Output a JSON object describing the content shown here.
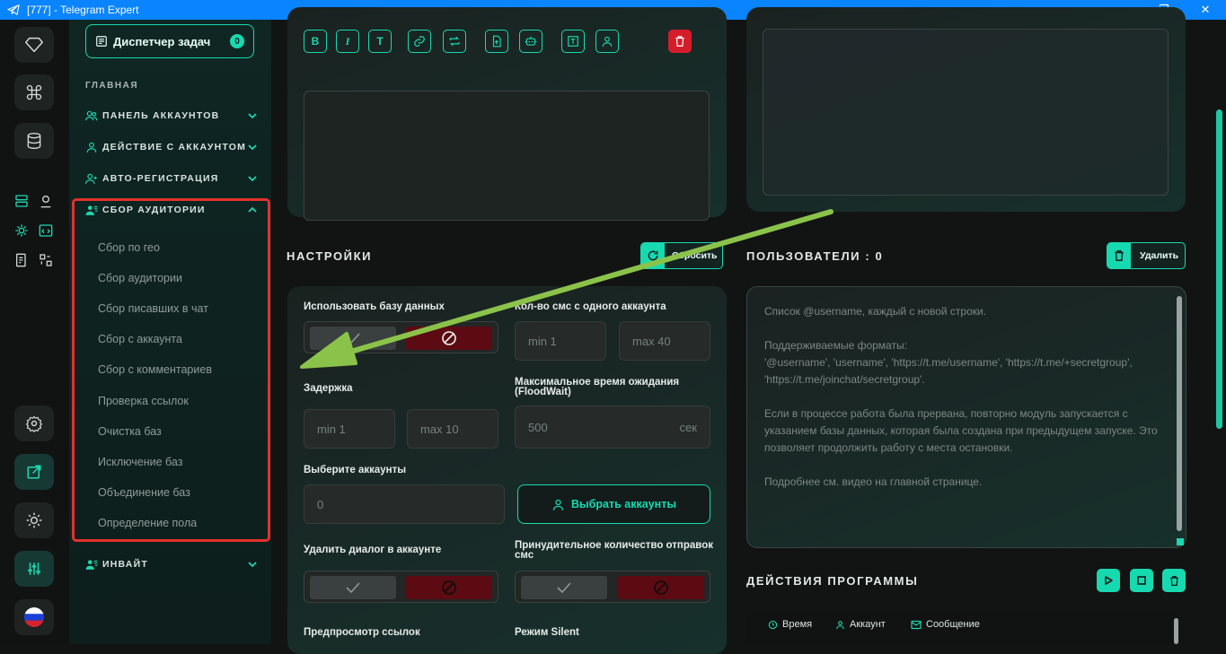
{
  "window": {
    "title": "[777] - Telegram Expert",
    "minimize": "—",
    "maximize": "❐",
    "close": "✕"
  },
  "colors": {
    "accent": "#17d9b0",
    "danger": "#d41d2a",
    "titlebar": "#0a84ff",
    "frame": "#e3312d",
    "arrow": "#8bc34a"
  },
  "sidebar": {
    "tasks_label": "Диспетчер задач",
    "tasks_count": "0",
    "section": "ГЛАВНАЯ",
    "items": [
      {
        "label": "ПАНЕЛЬ АККАУНТОВ",
        "icon": "users-icon",
        "expanded": false
      },
      {
        "label": "ДЕЙСТВИЕ С АККАУНТОМ",
        "icon": "user-icon",
        "expanded": false
      },
      {
        "label": "АВТО-РЕГИСТРАЦИЯ",
        "icon": "user-plus-icon",
        "expanded": false
      },
      {
        "label": "СБОР АУДИТОРИИ",
        "icon": "user-list-icon",
        "expanded": true
      },
      {
        "label": "ИНВАЙТ",
        "icon": "user-list-icon",
        "expanded": false
      }
    ],
    "sub_items": [
      "Сбор по гео",
      "Сбор аудитории",
      "Сбор писавших в чат",
      "Сбор с аккаунта",
      "Сбор с комментариев",
      "Проверка ссылок",
      "Очистка баз",
      "Исключение баз",
      "Объединение баз",
      "Определение пола"
    ]
  },
  "editor": {
    "tool_letters": {
      "bold": "B",
      "italic": "I",
      "text": "T"
    }
  },
  "settings": {
    "title": "НАСТРОЙКИ",
    "reset_label": "Сбросить",
    "use_db_label": "Использовать базу данных",
    "sms_per_account_label": "Кол-во смс с одного аккаунта",
    "sms_min": "min  1",
    "sms_max": "max  40",
    "delay_label": "Задержка",
    "delay_min": "min  1",
    "delay_max": "max  10",
    "floodwait_label": "Максимальное время ожидания (FloodWait)",
    "floodwait_value": "500",
    "floodwait_unit": "сек",
    "choose_accounts_label": "Выберите аккаунты",
    "accounts_value": "0",
    "choose_accounts_button": "Выбрать аккаунты",
    "delete_dialog_label": "Удалить диалог в аккаунте",
    "forced_count_label": "Принудительное количество отправок смс",
    "preview_links_label": "Предпросмотр ссылок",
    "silent_label": "Режим Silent"
  },
  "users": {
    "title": "ПОЛЬЗОВАТЕЛИ : 0",
    "delete_label": "Удалить",
    "placeholder": "Список @username, каждый с новой строки.\n\nПоддерживаемые форматы:\n'@username', 'username', 'https://t.me/username', 'https://t.me/+secretgroup', 'https://t.me/joinchat/secretgroup'.\n\nЕсли в процессе работа была прервана, повторно модуль запускается с указанием базы данных, которая была создана при предыдущем запуске. Это позволяет продолжить работу с места остановки.\n\nПодробнее см. видео на главной странице."
  },
  "actions": {
    "title": "ДЕЙСТВИЯ ПРОГРАММЫ",
    "col_time": "Время",
    "col_account": "Аккаунт",
    "col_message": "Сообщение"
  }
}
